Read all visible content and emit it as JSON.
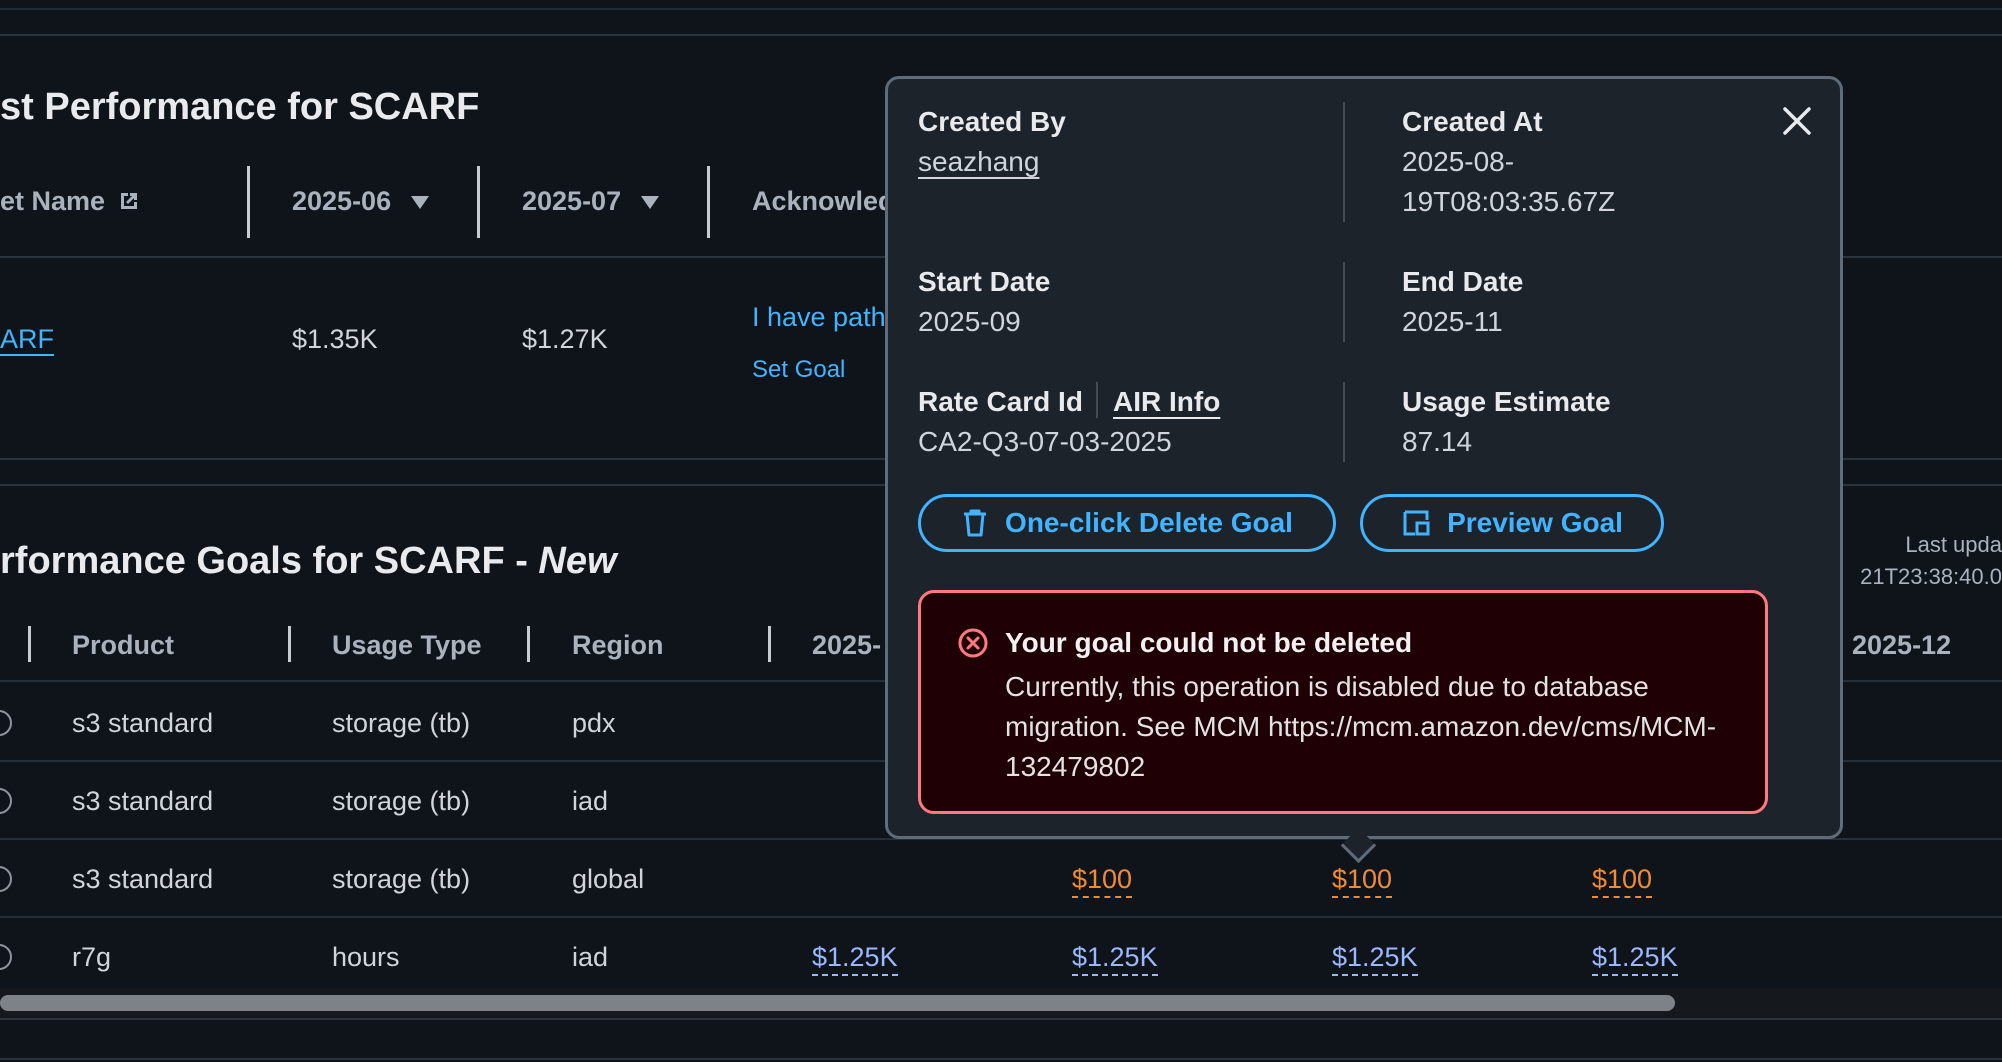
{
  "section1": {
    "title": "st Performance for SCARF",
    "headers": {
      "name": "et Name",
      "c1": "2025-06",
      "c2": "2025-07",
      "ack": "Acknowled"
    },
    "row": {
      "name": "ARF",
      "c1": "$1.35K",
      "c2": "$1.27K",
      "ack_text": "I have path",
      "set_goal": "Set Goal"
    }
  },
  "section2": {
    "title": "rformance Goals for SCARF - ",
    "title_new": "New",
    "last_updated_label": "Last upda",
    "last_updated_value": "21T23:38:40.0",
    "headers": {
      "product": "Product",
      "usage_type": "Usage Type",
      "region": "Region",
      "m1": "2025-",
      "m4": "2025-12"
    },
    "rows": [
      {
        "product": "s3 standard",
        "usage_type": "storage (tb)",
        "region": "pdx"
      },
      {
        "product": "s3 standard",
        "usage_type": "storage (tb)",
        "region": "iad"
      },
      {
        "product": "s3 standard",
        "usage_type": "storage (tb)",
        "region": "global",
        "v2": "$100",
        "v3": "$100",
        "v4": "$100"
      },
      {
        "product": "r7g",
        "usage_type": "hours",
        "region": "iad",
        "v1": "$1.25K",
        "v2": "$1.25K",
        "v3": "$1.25K",
        "v4": "$1.25K"
      }
    ]
  },
  "popover": {
    "created_by_label": "Created By",
    "created_by_value": "seazhang",
    "created_at_label": "Created At",
    "created_at_line1": "2025-08-",
    "created_at_line2": "19T08:03:35.67Z",
    "start_date_label": "Start Date",
    "start_date_value": "2025-09",
    "end_date_label": "End Date",
    "end_date_value": "2025-11",
    "rate_card_label": "Rate Card Id",
    "air_info_link": "AIR Info",
    "rate_card_value": "CA2-Q3-07-03-2025",
    "usage_estimate_label": "Usage Estimate",
    "usage_estimate_value": "87.14",
    "delete_button": "One-click Delete Goal",
    "preview_button": "Preview Goal",
    "alert_title": "Your goal could not be deleted",
    "alert_body": "Currently, this operation is disabled due to database migration. See MCM https://mcm.amazon.dev/cms/MCM-132479802"
  },
  "colors": {
    "link": "#42b4ff",
    "error": "#ff7a7f",
    "warning_value": "#f28a33",
    "value_link": "#9bb8ff"
  }
}
